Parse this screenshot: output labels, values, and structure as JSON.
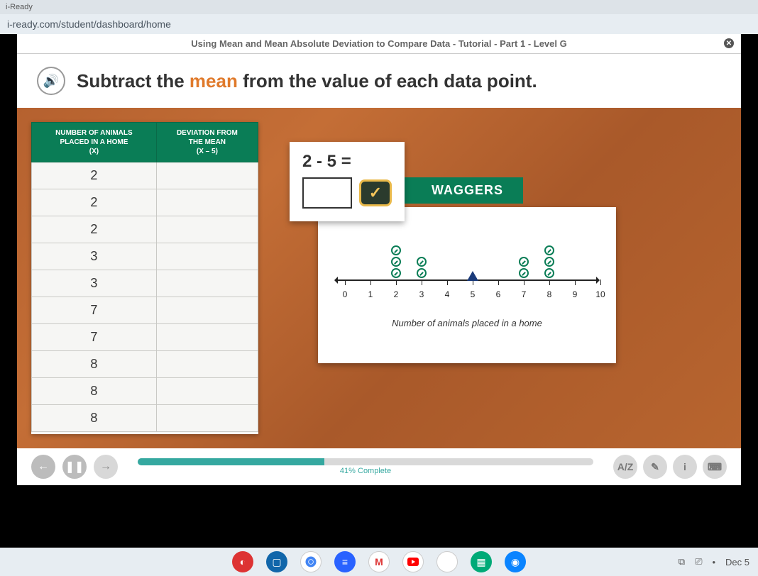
{
  "browser": {
    "tab_fragment": "i-Ready",
    "url": "i-ready.com/student/dashboard/home"
  },
  "lesson": {
    "title": "Using Mean and Mean Absolute Deviation to Compare Data - Tutorial - Part 1 - Level G",
    "instruction_pre": "Subtract the ",
    "instruction_hl": "mean",
    "instruction_post": " from the value of each data point."
  },
  "table": {
    "col1_header": "NUMBER OF ANIMALS\nPLACED IN A HOME\n(X)",
    "col2_header": "DEVIATION FROM\nTHE MEAN\n(X – 5)",
    "rows": [
      {
        "x": "2",
        "dev": ""
      },
      {
        "x": "2",
        "dev": ""
      },
      {
        "x": "2",
        "dev": ""
      },
      {
        "x": "3",
        "dev": ""
      },
      {
        "x": "3",
        "dev": ""
      },
      {
        "x": "7",
        "dev": ""
      },
      {
        "x": "7",
        "dev": ""
      },
      {
        "x": "8",
        "dev": ""
      },
      {
        "x": "8",
        "dev": ""
      },
      {
        "x": "8",
        "dev": ""
      }
    ]
  },
  "prompt": {
    "equation": "2 - 5 =",
    "answer": "",
    "check_glyph": "✓"
  },
  "banner": "WAGGERS",
  "dotplot": {
    "caption": "Number of animals placed in a home",
    "ticks": [
      "0",
      "1",
      "2",
      "3",
      "4",
      "5",
      "6",
      "7",
      "8",
      "9",
      "10"
    ],
    "mean": 5
  },
  "player": {
    "back_glyph": "←",
    "pause_glyph": "❚❚",
    "fwd_glyph": "→",
    "progress_pct": 41,
    "progress_label": "41% Complete",
    "tools": {
      "az": "A/Z",
      "pen": "✎",
      "info": "i",
      "calc": "⌨"
    }
  },
  "shelf": {
    "date": "Dec 5"
  },
  "chart_data": {
    "type": "dotplot",
    "title": "WAGGERS",
    "xlabel": "Number of animals placed in a home",
    "x_ticks": [
      0,
      1,
      2,
      3,
      4,
      5,
      6,
      7,
      8,
      9,
      10
    ],
    "xlim": [
      0,
      10
    ],
    "points": [
      {
        "x": 2,
        "count": 3
      },
      {
        "x": 3,
        "count": 2
      },
      {
        "x": 7,
        "count": 2
      },
      {
        "x": 8,
        "count": 3
      }
    ],
    "mean_marker": 5
  }
}
